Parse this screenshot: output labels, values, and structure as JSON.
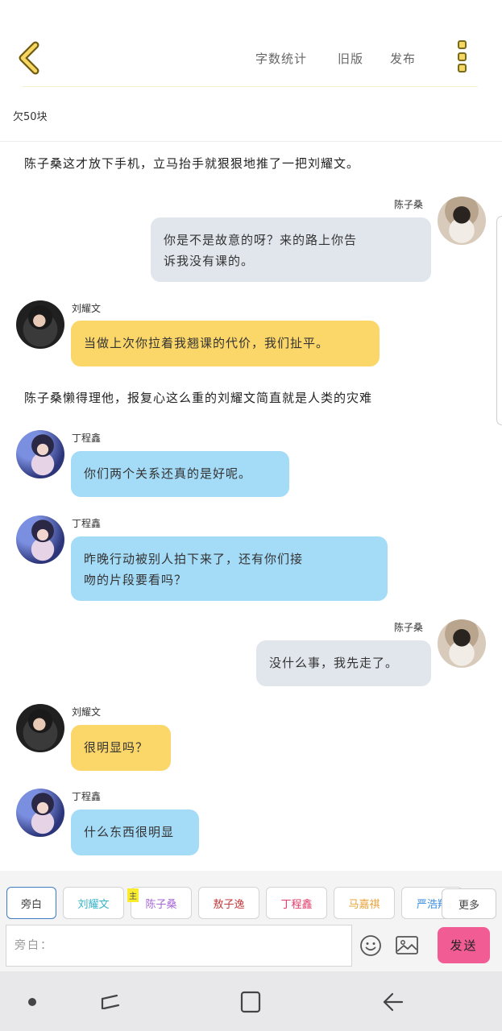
{
  "header": {
    "links": {
      "word_count": "字数统计",
      "old_version": "旧版",
      "publish": "发布"
    }
  },
  "subinfo": "欠50块",
  "chat": {
    "narration_1": "陈子桑这才放下手机，立马抬手就狠狠地推了一把刘耀文。",
    "narration_2": "陈子桑懒得理他，报复心这么重的刘耀文简直就是人类的灾难",
    "messages": [
      {
        "name": "陈子桑",
        "lines": [
          "你是不是故意的呀？来的路上你告",
          "诉我没有课的。"
        ]
      },
      {
        "name": "刘耀文",
        "text": "当做上次你拉着我翘课的代价，我们扯平。"
      },
      {
        "name": "丁程鑫",
        "text": "你们两个关系还真的是好呢。"
      },
      {
        "name": "丁程鑫",
        "lines": [
          "昨晚行动被别人拍下来了，还有你们接",
          "吻的片段要看吗？"
        ]
      },
      {
        "name": "陈子桑",
        "text": "没什么事，我先走了。"
      },
      {
        "name": "刘耀文",
        "text": "很明显吗？"
      },
      {
        "name": "丁程鑫",
        "text": "什么东西很明显"
      }
    ]
  },
  "roles": {
    "chips": [
      "旁白",
      "刘耀文",
      "陈子桑",
      "敖子逸",
      "丁程鑫",
      "马嘉祺",
      "严浩翔"
    ],
    "main_tag": "主",
    "more": "更多",
    "colors": {
      "刘耀文": "#33b3c9",
      "陈子桑": "#a566d6",
      "敖子逸": "#c23b3b",
      "丁程鑫": "#e03b6a",
      "马嘉祺": "#e9a238",
      "严浩翔": "#3a8ee0"
    }
  },
  "input": {
    "placeholder": "旁白：",
    "send": "发送"
  },
  "icons": {
    "back": "chevron-left-icon",
    "more": "more-vertical-icon",
    "emoji": "smiley-icon",
    "image": "image-icon"
  }
}
